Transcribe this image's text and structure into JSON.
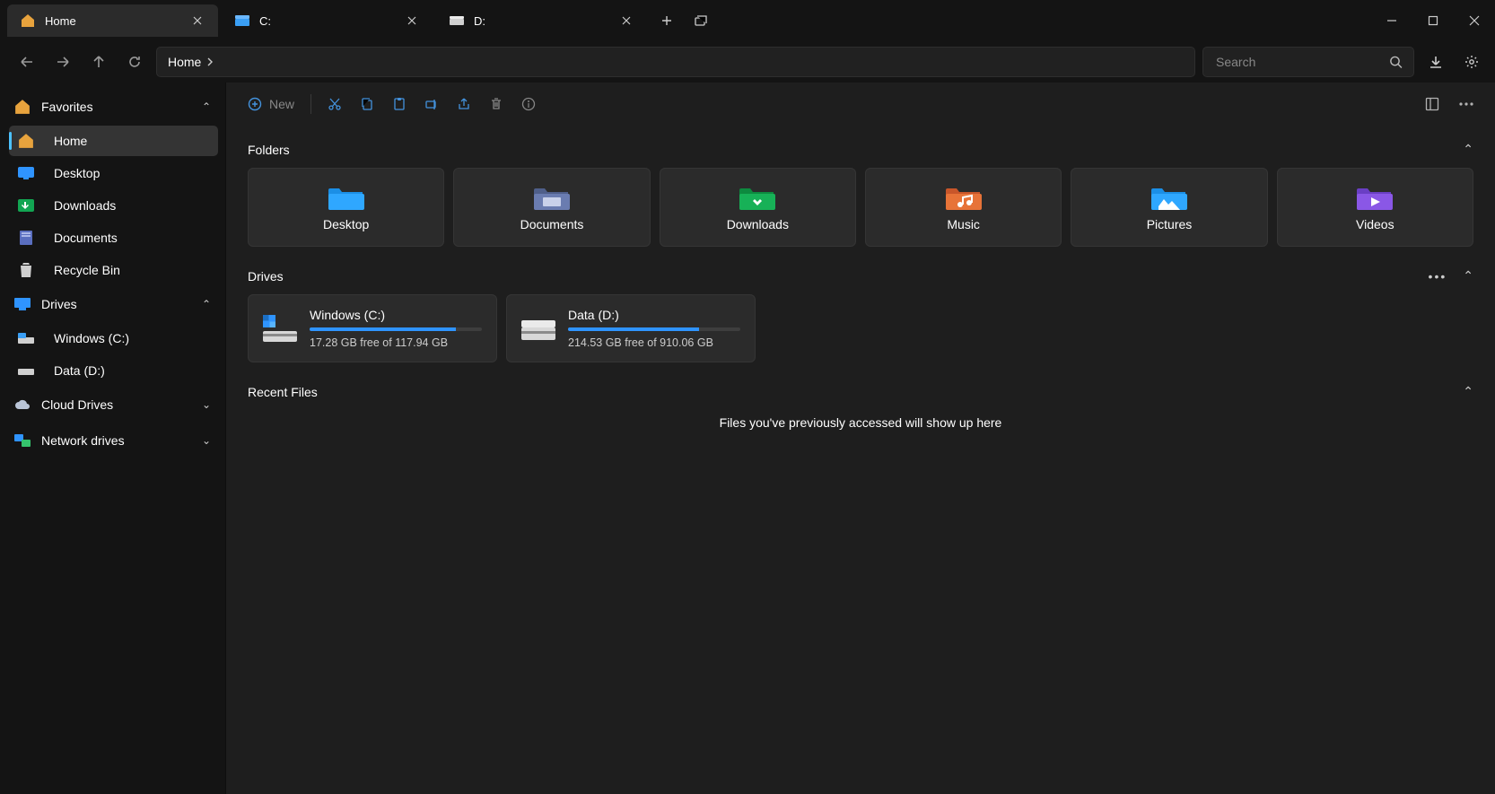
{
  "tabs": [
    {
      "label": "Home",
      "icon": "home",
      "active": true
    },
    {
      "label": "C:",
      "icon": "drive",
      "active": false
    },
    {
      "label": "D:",
      "icon": "drive",
      "active": false
    }
  ],
  "nav": {
    "address": "Home"
  },
  "search": {
    "placeholder": "Search"
  },
  "toolbar": {
    "new_label": "New"
  },
  "sidebar": {
    "sections": {
      "favorites": {
        "label": "Favorites",
        "expanded": true,
        "items": [
          {
            "label": "Home",
            "icon": "home",
            "active": true
          },
          {
            "label": "Desktop",
            "icon": "desktop"
          },
          {
            "label": "Downloads",
            "icon": "downloads"
          },
          {
            "label": "Documents",
            "icon": "documents"
          },
          {
            "label": "Recycle Bin",
            "icon": "recycle"
          }
        ]
      },
      "drives": {
        "label": "Drives",
        "expanded": true,
        "items": [
          {
            "label": "Windows (C:)",
            "icon": "drive-c"
          },
          {
            "label": "Data (D:)",
            "icon": "drive"
          }
        ]
      },
      "cloud": {
        "label": "Cloud Drives",
        "expanded": false
      },
      "network": {
        "label": "Network drives",
        "expanded": false
      }
    }
  },
  "sections": {
    "folders": {
      "title": "Folders",
      "items": [
        {
          "label": "Desktop"
        },
        {
          "label": "Documents"
        },
        {
          "label": "Downloads"
        },
        {
          "label": "Music"
        },
        {
          "label": "Pictures"
        },
        {
          "label": "Videos"
        }
      ]
    },
    "drives": {
      "title": "Drives",
      "items": [
        {
          "name": "Windows (C:)",
          "free": "17.28 GB free of 117.94 GB",
          "fill_pct": 85
        },
        {
          "name": "Data (D:)",
          "free": "214.53 GB free of 910.06 GB",
          "fill_pct": 76
        }
      ]
    },
    "recent": {
      "title": "Recent Files",
      "empty_msg": "Files you've previously accessed will show up here"
    }
  }
}
